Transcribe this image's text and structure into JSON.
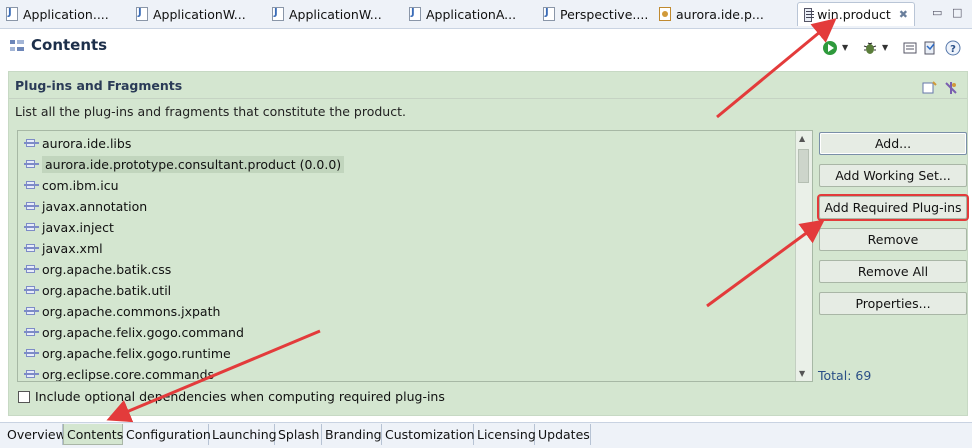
{
  "editor_tabs": [
    {
      "label": "Application....",
      "icon": "java-file-icon"
    },
    {
      "label": "ApplicationW...",
      "icon": "java-file-icon"
    },
    {
      "label": "ApplicationW...",
      "icon": "java-file-icon"
    },
    {
      "label": "ApplicationA...",
      "icon": "java-file-icon"
    },
    {
      "label": "Perspective....",
      "icon": "java-file-icon"
    },
    {
      "label": "aurora.ide.p...",
      "icon": "plugin-file-icon"
    },
    {
      "label": "win.product",
      "icon": "product-file-icon",
      "active": true
    }
  ],
  "header": {
    "title": "Contents"
  },
  "section": {
    "title": "Plug-ins and Fragments",
    "description": "List all the plug-ins and fragments that constitute the product."
  },
  "plugins": [
    "aurora.ide.libs",
    "aurora.ide.prototype.consultant.product (0.0.0)",
    "com.ibm.icu",
    "javax.annotation",
    "javax.inject",
    "javax.xml",
    "org.apache.batik.css",
    "org.apache.batik.util",
    "org.apache.commons.jxpath",
    "org.apache.felix.gogo.command",
    "org.apache.felix.gogo.runtime",
    "org.eclipse.core.commands"
  ],
  "selected_plugin_index": 1,
  "buttons": {
    "add": "Add...",
    "add_working_set": "Add Working Set...",
    "add_required": "Add Required Plug-ins",
    "remove": "Remove",
    "remove_all": "Remove All",
    "properties": "Properties..."
  },
  "total": "Total: 69",
  "include_optional": {
    "label": "Include optional dependencies when computing required plug-ins",
    "checked": false
  },
  "bottom_tabs": [
    "Overview",
    "Contents",
    "Configuration",
    "Launching",
    "Splash",
    "Branding",
    "Customization",
    "Licensing",
    "Updates"
  ],
  "active_bottom_tab": "Contents",
  "colors": {
    "annotation_red": "#e33b3b",
    "section_bg": "#d4e6d0"
  }
}
